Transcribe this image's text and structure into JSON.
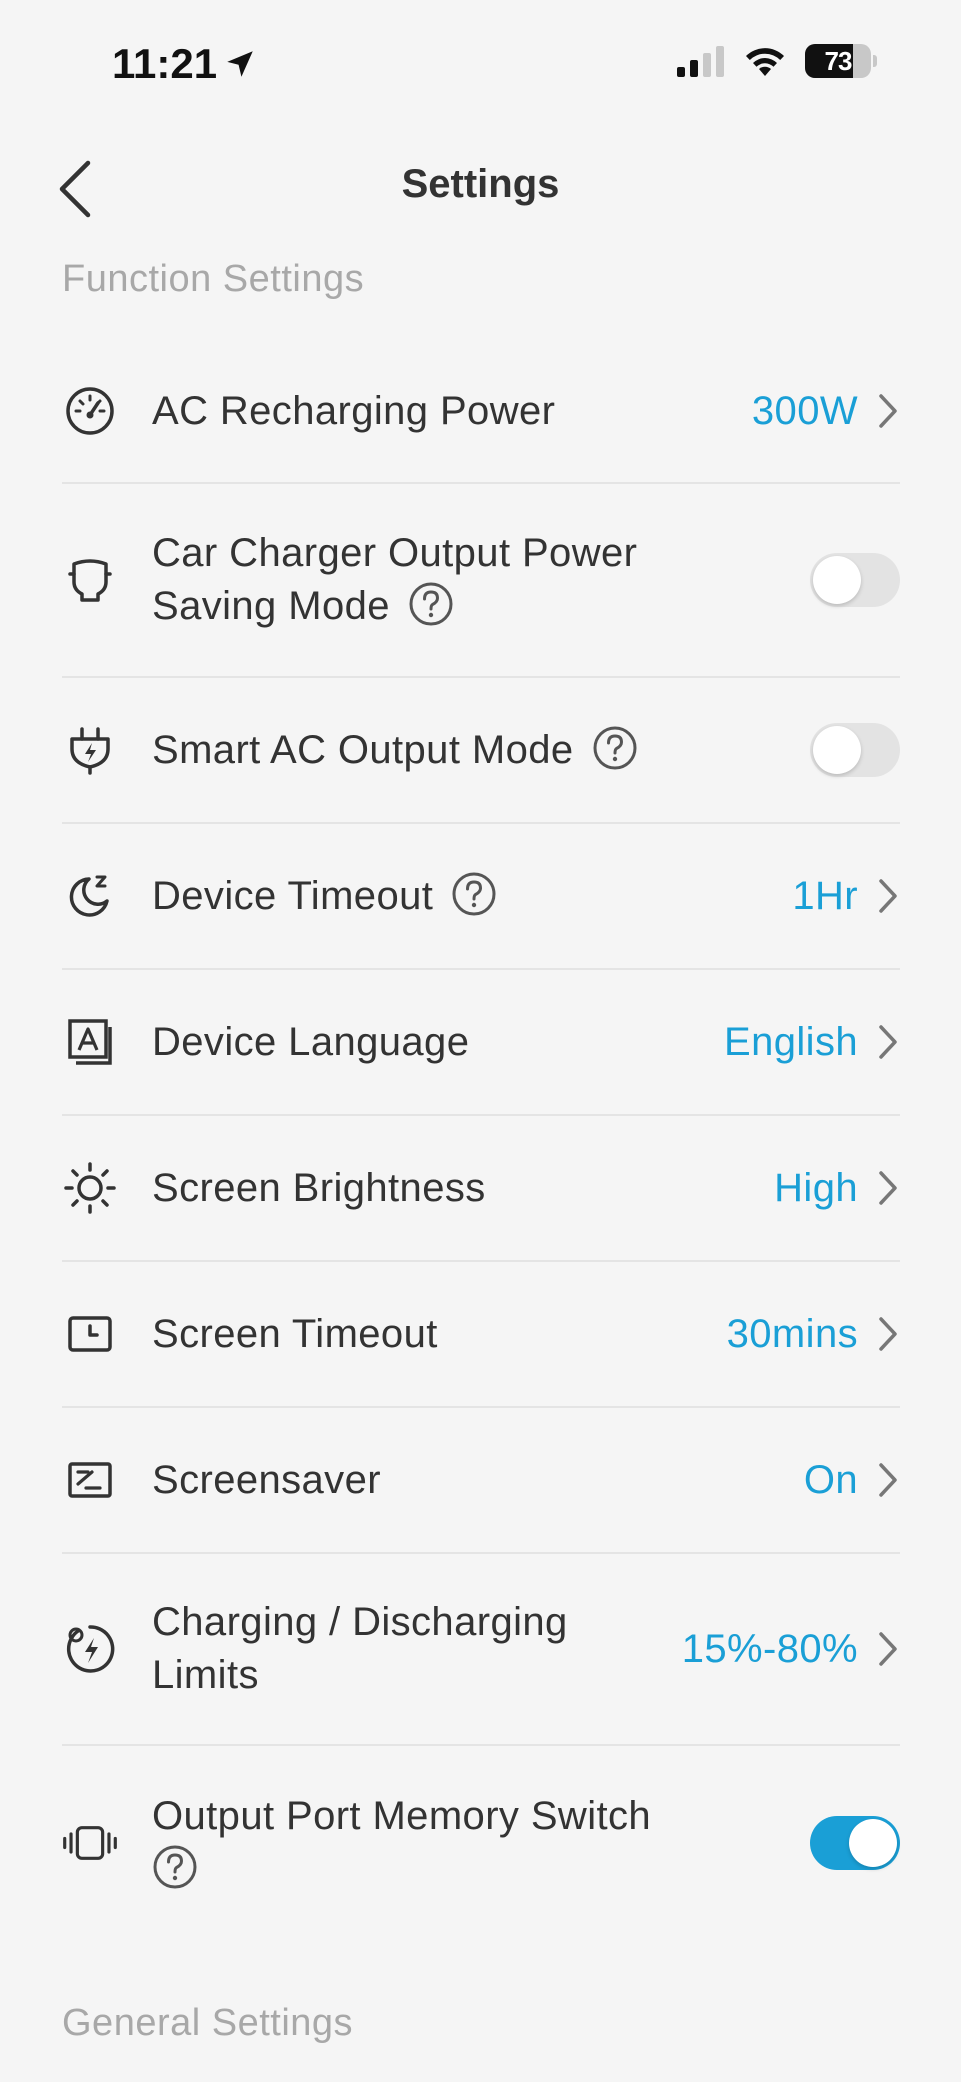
{
  "status_bar": {
    "time": "11:21",
    "battery_level": "73"
  },
  "header": {
    "title": "Settings"
  },
  "sections": {
    "function_title": "Function Settings",
    "general_title": "General Settings"
  },
  "rows": [
    {
      "label": "AC Recharging Power",
      "value": "300W",
      "icon": "speedometer-icon",
      "type": "value"
    },
    {
      "label_line1": "Car Charger Output Power",
      "label_line2": "Saving Mode",
      "icon": "car-charger-icon",
      "type": "toggle",
      "toggle_on": false,
      "help": true
    },
    {
      "label": "Smart AC Output Mode",
      "icon": "smart-plug-icon",
      "type": "toggle",
      "toggle_on": false,
      "help": true
    },
    {
      "label": "Device Timeout",
      "value": "1Hr",
      "icon": "moon-sleep-icon",
      "type": "value",
      "help": true
    },
    {
      "label": "Device Language",
      "value": "English",
      "icon": "language-icon",
      "type": "value"
    },
    {
      "label": "Screen Brightness",
      "value": "High",
      "icon": "sun-icon",
      "type": "value"
    },
    {
      "label": "Screen Timeout",
      "value": "30mins",
      "icon": "screen-clock-icon",
      "type": "value"
    },
    {
      "label": "Screensaver",
      "value": "On",
      "icon": "screensaver-icon",
      "type": "value"
    },
    {
      "label_line1": "Charging / Discharging",
      "label_line2": "Limits",
      "value": "15%-80%",
      "icon": "battery-limit-icon",
      "type": "value"
    },
    {
      "label_line1": "Output Port Memory Switch",
      "icon": "vibrate-port-icon",
      "type": "toggle",
      "toggle_on": true,
      "help": true
    }
  ],
  "colors": {
    "accent": "#1a9fd6",
    "background": "#f5f5f5",
    "text": "#333333",
    "section_title": "#a8a8a8",
    "divider": "#e4e4e4"
  }
}
